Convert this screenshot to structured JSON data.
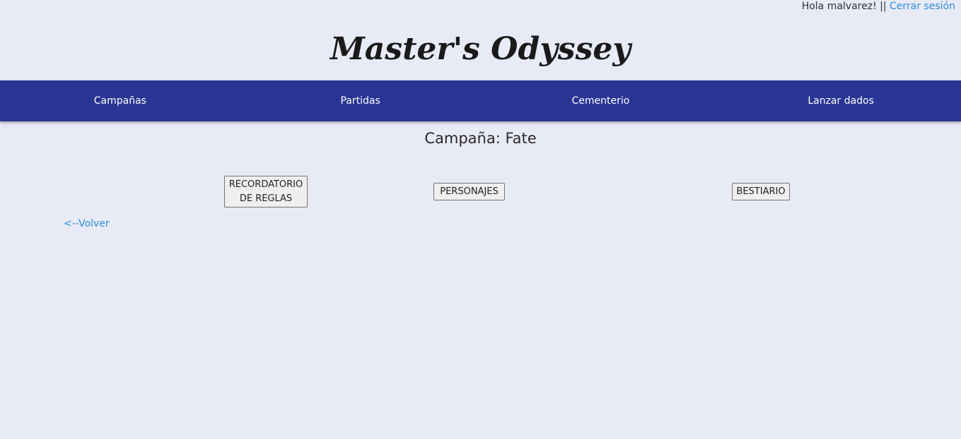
{
  "header": {
    "greeting": "Hola malvarez! ||",
    "logout_label": "Cerrar sesión"
  },
  "brand": {
    "title": "Master's Odyssey"
  },
  "nav": {
    "items": [
      {
        "label": "Campañas"
      },
      {
        "label": "Partidas"
      },
      {
        "label": "Cementerio"
      },
      {
        "label": "Lanzar dados"
      }
    ]
  },
  "main": {
    "campaign_title": "Campaña: Fate",
    "buttons": {
      "reglas": "RECORDATORIO\nDE REGLAS",
      "personajes": "PERSONAJES",
      "bestiario": "BESTIARIO"
    },
    "back_link": "<--Volver"
  },
  "colors": {
    "background": "#e8eaf6",
    "navbar": "#283593",
    "link": "#2e8fd8"
  }
}
